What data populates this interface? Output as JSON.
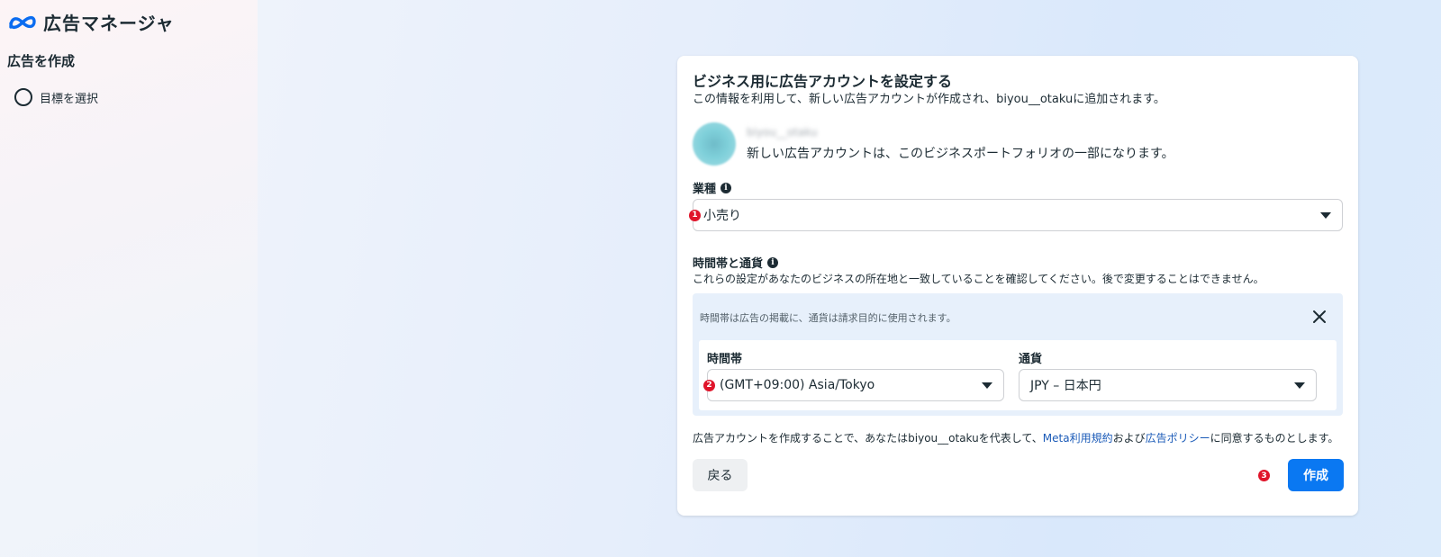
{
  "app": {
    "title": "広告マネージャ",
    "logo_icon": "meta-logo-icon"
  },
  "sidebar": {
    "heading": "広告を作成",
    "steps": [
      {
        "label": "目標を選択",
        "icon": "circle-outline-icon"
      }
    ]
  },
  "card": {
    "title": "ビジネス用に広告アカウントを設定する",
    "subtitle": "この情報を利用して、新しい広告アカウントが作成され、biyou__otakuに追加されます。",
    "account": {
      "name": "biyou__otaku",
      "description": "新しい広告アカウントは、このビジネスポートフォリオの一部になります。"
    },
    "industry": {
      "label": "業種",
      "badge": "1",
      "value": "小売り"
    },
    "tz_currency": {
      "label": "時間帯と通貨",
      "description": "これらの設定があなたのビジネスの所在地と一致していることを確認してください。後で変更することはできません。",
      "note": "時間帯は広告の掲載に、通貨は請求目的に使用されます。",
      "timezone_label": "時間帯",
      "timezone_badge": "2",
      "timezone_value": "(GMT+09:00) Asia/Tokyo",
      "currency_label": "通貨",
      "currency_value": "JPY – 日本円"
    },
    "terms": {
      "prefix": "広告アカウントを作成することで、あなたはbiyou__otakuを代表して、",
      "link1": "Meta利用規約",
      "middle": "および",
      "link2": "広告ポリシー",
      "suffix": "に同意するものとします。"
    },
    "back_label": "戻る",
    "create_badge": "3",
    "create_label": "作成"
  },
  "colors": {
    "primary_button": "#0a78f2",
    "link": "#1b5bb8",
    "badge": "#e0142a",
    "panel": "#e7f0fb"
  }
}
